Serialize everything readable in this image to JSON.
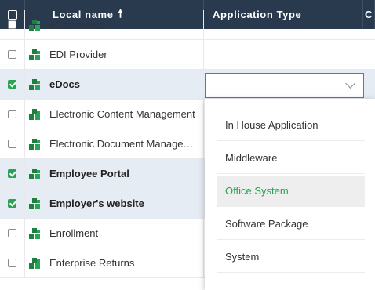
{
  "header": {
    "name_label": "Local name",
    "sort_icon": "arrow-up-icon",
    "type_label": "Application Type",
    "more_label": "C"
  },
  "rows": [
    {
      "label": "eCommerce",
      "checked": false,
      "selected": false
    },
    {
      "label": "EDI Provider",
      "checked": false,
      "selected": false
    },
    {
      "label": "eDocs",
      "checked": true,
      "selected": true
    },
    {
      "label": "Electronic Content Management",
      "checked": false,
      "selected": false
    },
    {
      "label": "Electronic Document Management",
      "checked": false,
      "selected": false
    },
    {
      "label": "Employee Portal",
      "checked": true,
      "selected": true
    },
    {
      "label": "Employer's website",
      "checked": true,
      "selected": true
    },
    {
      "label": "Enrollment",
      "checked": false,
      "selected": false
    },
    {
      "label": "Enterprise Returns",
      "checked": false,
      "selected": false
    }
  ],
  "select": {
    "value": ""
  },
  "dropdown": {
    "options": [
      {
        "label": "In House Application",
        "active": false
      },
      {
        "label": "Middleware",
        "active": false
      },
      {
        "label": "Office System",
        "active": true
      },
      {
        "label": "Software Package",
        "active": false
      },
      {
        "label": "System",
        "active": false
      }
    ]
  },
  "colors": {
    "header_bg": "#2a3a4e",
    "accent_green": "#27a353",
    "selected_row_bg": "#e6ecf4",
    "icon_green": "#1e7f3e"
  }
}
